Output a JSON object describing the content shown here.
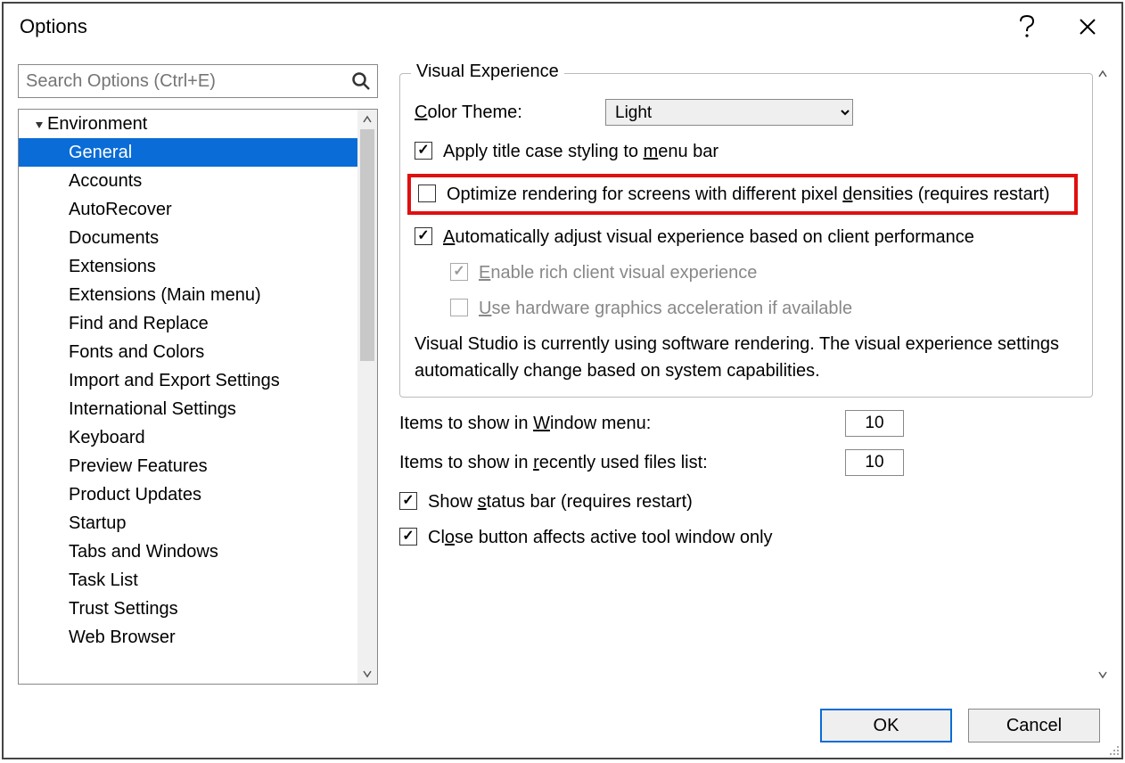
{
  "window": {
    "title": "Options"
  },
  "search": {
    "placeholder": "Search Options (Ctrl+E)"
  },
  "tree": {
    "root": "Environment",
    "items": [
      "General",
      "Accounts",
      "AutoRecover",
      "Documents",
      "Extensions",
      "Extensions (Main menu)",
      "Find and Replace",
      "Fonts and Colors",
      "Import and Export Settings",
      "International Settings",
      "Keyboard",
      "Preview Features",
      "Product Updates",
      "Startup",
      "Tabs and Windows",
      "Task List",
      "Trust Settings",
      "Web Browser"
    ],
    "selected": "General"
  },
  "group": {
    "legend": "Visual Experience",
    "colorTheme": {
      "label": "Color Theme:",
      "value": "Light"
    },
    "chkTitleCase": "Apply title case styling to menu bar",
    "chkOptimize": "Optimize rendering for screens with different pixel densities (requires restart)",
    "chkAuto": "Automatically adjust visual experience based on client performance",
    "chkRich": "Enable rich client visual experience",
    "chkHW": "Use hardware graphics acceleration if available",
    "info": "Visual Studio is currently using software rendering.  The visual experience settings automatically change based on system capabilities."
  },
  "nums": {
    "windowMenu": {
      "label": "Items to show in Window menu:",
      "value": "10"
    },
    "recent": {
      "label": "Items to show in recently used files list:",
      "value": "10"
    }
  },
  "extraChecks": {
    "status": "Show status bar (requires restart)",
    "closeBtn": "Close button affects active tool window only"
  },
  "buttons": {
    "ok": "OK",
    "cancel": "Cancel"
  }
}
